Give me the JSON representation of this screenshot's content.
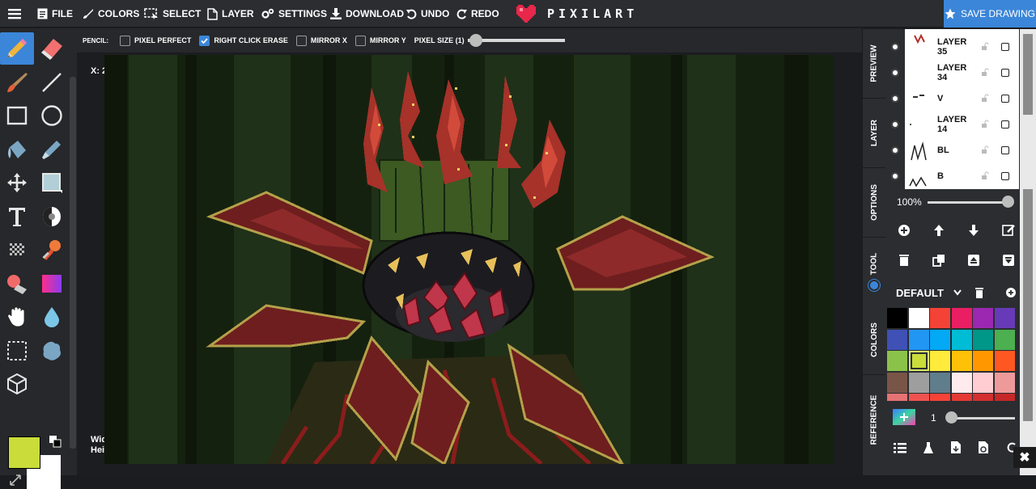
{
  "topbar": {
    "file": "FILE",
    "colors": "COLORS",
    "select": "SELECT",
    "layer": "LAYER",
    "settings": "SETTINGS",
    "download": "DOWNLOAD",
    "undo": "UNDO",
    "redo": "REDO",
    "logo": "PIXILART",
    "save": "SAVE DRAWING"
  },
  "tool_options": {
    "tool_name": "PENCIL:",
    "pixel_perfect": "PIXEL PERFECT",
    "pixel_perfect_checked": false,
    "right_click_erase": "RIGHT CLICK ERASE",
    "right_click_erase_checked": true,
    "mirror_x": "MIRROR X",
    "mirror_x_checked": false,
    "mirror_y": "MIRROR Y",
    "mirror_y_checked": false,
    "pixel_size": "PIXEL SIZE (1)",
    "pixel_size_value": 1
  },
  "canvas": {
    "coord": "X: 2",
    "width_label": "Wid",
    "height_label": "Hei"
  },
  "colors": {
    "primary": "#c9dc3a",
    "secondary": "#ffffff",
    "accent": "#3b86d9"
  },
  "side_tabs": [
    "PREVIEW",
    "LAYER",
    "OPTIONS",
    "TOOL",
    "COLORS",
    "REFERENCE"
  ],
  "layers": [
    {
      "name": "LAYER 35",
      "visible": true
    },
    {
      "name": "LAYER 34",
      "visible": true
    },
    {
      "name": "V",
      "visible": true
    },
    {
      "name": "LAYER 14",
      "visible": true
    },
    {
      "name": "BL",
      "visible": true
    },
    {
      "name": "B",
      "visible": true
    }
  ],
  "layer_opacity": "100%",
  "layer_opacity_value": 100,
  "palette": {
    "name": "DEFAULT",
    "swatches": [
      "#000000",
      "#ffffff",
      "#f44336",
      "#e91e63",
      "#9c27b0",
      "#673ab7",
      "#3f51b5",
      "#2196f3",
      "#03a9f4",
      "#00bcd4",
      "#009688",
      "#4caf50",
      "#8bc34a",
      "#c9dc3a",
      "#ffeb3b",
      "#ffc107",
      "#ff9800",
      "#ff5722",
      "#795548",
      "#9e9e9e",
      "#607d8b",
      "#ffebee",
      "#ffcdd2",
      "#ef9a9a",
      "#e57373",
      "#ef5350",
      "#f44336",
      "#e53935",
      "#d32f2f",
      "#c62828"
    ],
    "selected_index": 13
  },
  "brush_size": "1",
  "close": "✖"
}
